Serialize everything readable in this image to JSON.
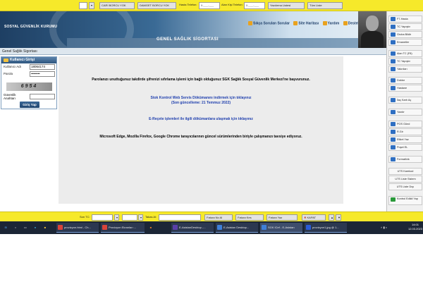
{
  "topbar": {
    "dropdown_value": "",
    "btn1": "CARİ BORCU YOK",
    "btn2": "DAMGET BORCU YOK",
    "hasta_tel_label": "Hasta Telefon:",
    "hasta_tel_value": "0-___-___",
    "alan_tel_label": "Alan Kişi Telefon:",
    "alan_tel_value": "0-___-___",
    "list1": "Yazdırma Listesi",
    "list2": "Tüm Liste"
  },
  "banner": {
    "org": "SOSYAL GÜVENLİK KURUMU",
    "title": "GENEL SAĞLIK SİGORTASI",
    "links": [
      "Sıkça Sorulan Sorular",
      "Site Haritası",
      "Yardım",
      "Destek"
    ]
  },
  "breadcrumb": "Genel Sağlık Sigortası",
  "login": {
    "title": "Kullanıcı Girişi",
    "user_label": "Kullanıcı Adı",
    "user_value": "18064174",
    "pass_label": "Parola",
    "pass_value": "••••••••",
    "captcha": "6954",
    "sec_label": "Güvenlik Anahtarı",
    "sec_value": "",
    "submit": "Giriş Yap"
  },
  "content": {
    "msg1": "Parolanızı unuttuğunuz takdirde şifrenizi sıfırlama işlemi için bağlı olduğunuz SGK Sağlık Sosyal Güvenlik Merkezi'ne başvurunuz.",
    "link1a": "Stok Kontrol Web Servis Dökümanını indirmek için tıklayınız",
    "link1b": "(Son güncelleme: 21 Temmuz 2022)",
    "link2": "E-Reçete işlemleri ile ilgili dökümanlara ulaşmak için tıklayınız",
    "msg2": "Microsoft Edge, Mozilla Firefox, Google Chrome tarayıcılarının güncel sürümlerinden biriyle çalışmanızı tavsiye ediyoruz."
  },
  "sidebar": [
    {
      "label": "F7-Hasta",
      "icon": "user-icon",
      "color": "#2f6fc2"
    },
    {
      "label": "TC Yapıştır",
      "icon": "paste-icon",
      "color": "#2f6fc2"
    },
    {
      "label": "Gruba Bildir",
      "icon": "group-icon",
      "color": "#2f6fc2"
    },
    {
      "label": "Emanetler",
      "icon": "box-icon",
      "color": "#2f6fc2"
    },
    {
      "label": "Alan TC (F8)",
      "icon": "user-icon",
      "color": "#2f6fc2"
    },
    {
      "label": "TC Yapıştır",
      "icon": "paste-icon",
      "color": "#2f6fc2"
    },
    {
      "label": "Yakınları",
      "icon": "family-icon",
      "color": "#2f6fc2"
    },
    {
      "label": "Doktor",
      "icon": "doctor-icon",
      "color": "#2f6fc2"
    },
    {
      "label": "Hastane",
      "icon": "hospital-icon",
      "color": "#2f6fc2"
    },
    {
      "label": "İlaç Kartı Aç",
      "icon": "pill-icon",
      "color": "#2f6fc2"
    },
    {
      "label": "Yazdır",
      "icon": "printer-icon",
      "color": "#2f6fc2"
    },
    {
      "label": "POS Gönd",
      "icon": "pos-icon",
      "color": "#2f6fc2"
    },
    {
      "label": "R.Gir",
      "icon": "edit-icon",
      "color": "#2f6fc2"
    },
    {
      "label": "Etiket Yaz",
      "icon": "label-icon",
      "color": "#2f6fc2"
    },
    {
      "label": "Poşet EL",
      "icon": "bag-icon",
      "color": "#2f6fc2"
    },
    {
      "label": "Formatlılık",
      "icon": "format-icon",
      "color": "#2f6fc2"
    },
    {
      "label": "UTS Karekod",
      "icon": "",
      "color": ""
    },
    {
      "label": "UTS Liste Sistem",
      "icon": "",
      "color": ""
    },
    {
      "label": "UTS Liste Dışı",
      "icon": "",
      "color": ""
    },
    {
      "label": "Kontrol Edildi Yap",
      "icon": "check-icon",
      "color": "#2a9a3a"
    }
  ],
  "bottombar": {
    "son_tc_label": "Son TC:",
    "son_tc_value": "",
    "field2": "",
    "field3": "",
    "takas_label": "Takas Al:",
    "takas_value": "",
    "fatura1": "Fatura No Al",
    "fatura2": "Fatura Kes",
    "fatura3": "Fatura Yaz",
    "kapat": "KAPAT"
  },
  "taskbar": {
    "search_placeholder": "",
    "apps": [
      {
        "label": "provizyon.html - Ch...",
        "icon": "chrome-icon",
        "color": "#d9443a"
      },
      {
        "label": "Provizyon Ekranları ...",
        "icon": "chrome-icon",
        "color": "#d9443a"
      },
      {
        "label": "E-AsistanDesktop -...",
        "icon": "app-icon",
        "color": "#5a3fa8"
      },
      {
        "label": "E-Asistan Desktop...",
        "icon": "app-icon",
        "color": "#3f7fd8"
      },
      {
        "label": "SGK ICef - E-Asistan",
        "icon": "app-icon",
        "color": "#3f7fd8"
      },
      {
        "label": "provizyon1.jpg @ 1...",
        "icon": "photoshop-icon",
        "color": "#2a5bd7"
      }
    ],
    "time": "14:01",
    "date": "12.03.2023"
  }
}
